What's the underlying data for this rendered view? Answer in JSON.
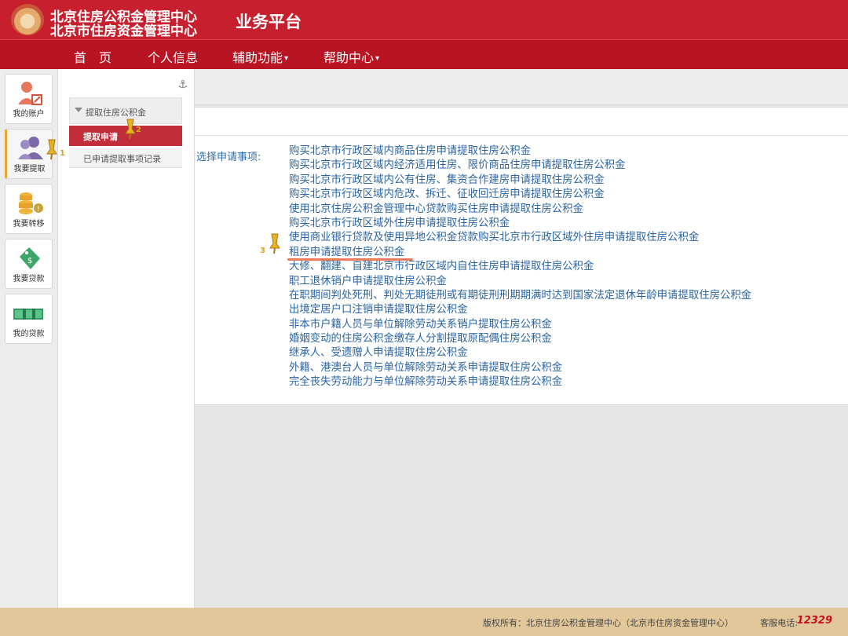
{
  "header": {
    "title_line1": "北京住房公积金管理中心",
    "title_line2": "北京市住房资金管理中心",
    "title_main": "业务平台"
  },
  "nav": {
    "items": [
      {
        "label": "首　页",
        "has_dropdown": false
      },
      {
        "label": "个人信息",
        "has_dropdown": false
      },
      {
        "label": "辅助功能",
        "has_dropdown": true
      },
      {
        "label": "帮助中心",
        "has_dropdown": true
      }
    ]
  },
  "iconbar": {
    "items": [
      {
        "label": "我的账户",
        "icon": "user-edit-icon",
        "active": false
      },
      {
        "label": "我要提取",
        "icon": "users-icon",
        "active": true
      },
      {
        "label": "我要转移",
        "icon": "coins-icon",
        "active": false
      },
      {
        "label": "我要贷款",
        "icon": "money-tag-icon",
        "active": false
      },
      {
        "label": "我的贷款",
        "icon": "cash-stack-icon",
        "active": false
      }
    ]
  },
  "submenu": {
    "group_label": "提取住房公积金",
    "active_item": "提取申请",
    "item": "已申请提取事项记录"
  },
  "content": {
    "select_label": "选择申请事项:",
    "options": [
      "购买北京市行政区域内商品住房申请提取住房公积金",
      "购买北京市行政区域内经济适用住房、限价商品住房申请提取住房公积金",
      "购买北京市行政区域内公有住房、集资合作建房申请提取住房公积金",
      "购买北京市行政区域内危改、拆迁、征收回迁房申请提取住房公积金",
      "使用北京住房公积金管理中心贷款购买住房申请提取住房公积金",
      "购买北京市行政区域外住房申请提取住房公积金",
      "使用商业银行贷款及使用异地公积金贷款购买北京市行政区域外住房申请提取住房公积金",
      "租房申请提取住房公积金",
      "大修、翻建、自建北京市行政区域内自住住房申请提取住房公积金",
      "职工退休销户申请提取住房公积金",
      "在职期间判处死刑、判处无期徒刑或有期徒刑刑期期满时达到国家法定退休年龄申请提取住房公积金",
      "出境定居户口注销申请提取住房公积金",
      "非本市户籍人员与单位解除劳动关系销户提取住房公积金",
      "婚姻变动的住房公积金缴存人分割提取原配偶住房公积金",
      "继承人、受遗赠人申请提取住房公积金",
      "外籍、港澳台人员与单位解除劳动关系申请提取住房公积金",
      "完全丧失劳动能力与单位解除劳动关系申请提取住房公积金"
    ],
    "highlighted_index": 7
  },
  "markers": {
    "m1": "1",
    "m2": "2",
    "m3": "3"
  },
  "footer": {
    "copyright": "版权所有：北京住房公积金管理中心（北京市住房资金管理中心）",
    "hotline_label": "客服电话:",
    "hotline_number": "12329"
  },
  "colors": {
    "header_red": "#c71f2d",
    "nav_red": "#b81424",
    "active_red": "#c12d3a",
    "link_blue": "#2a64a4",
    "footer_tan": "#e2c79a",
    "marker_gold": "#e8b321"
  }
}
